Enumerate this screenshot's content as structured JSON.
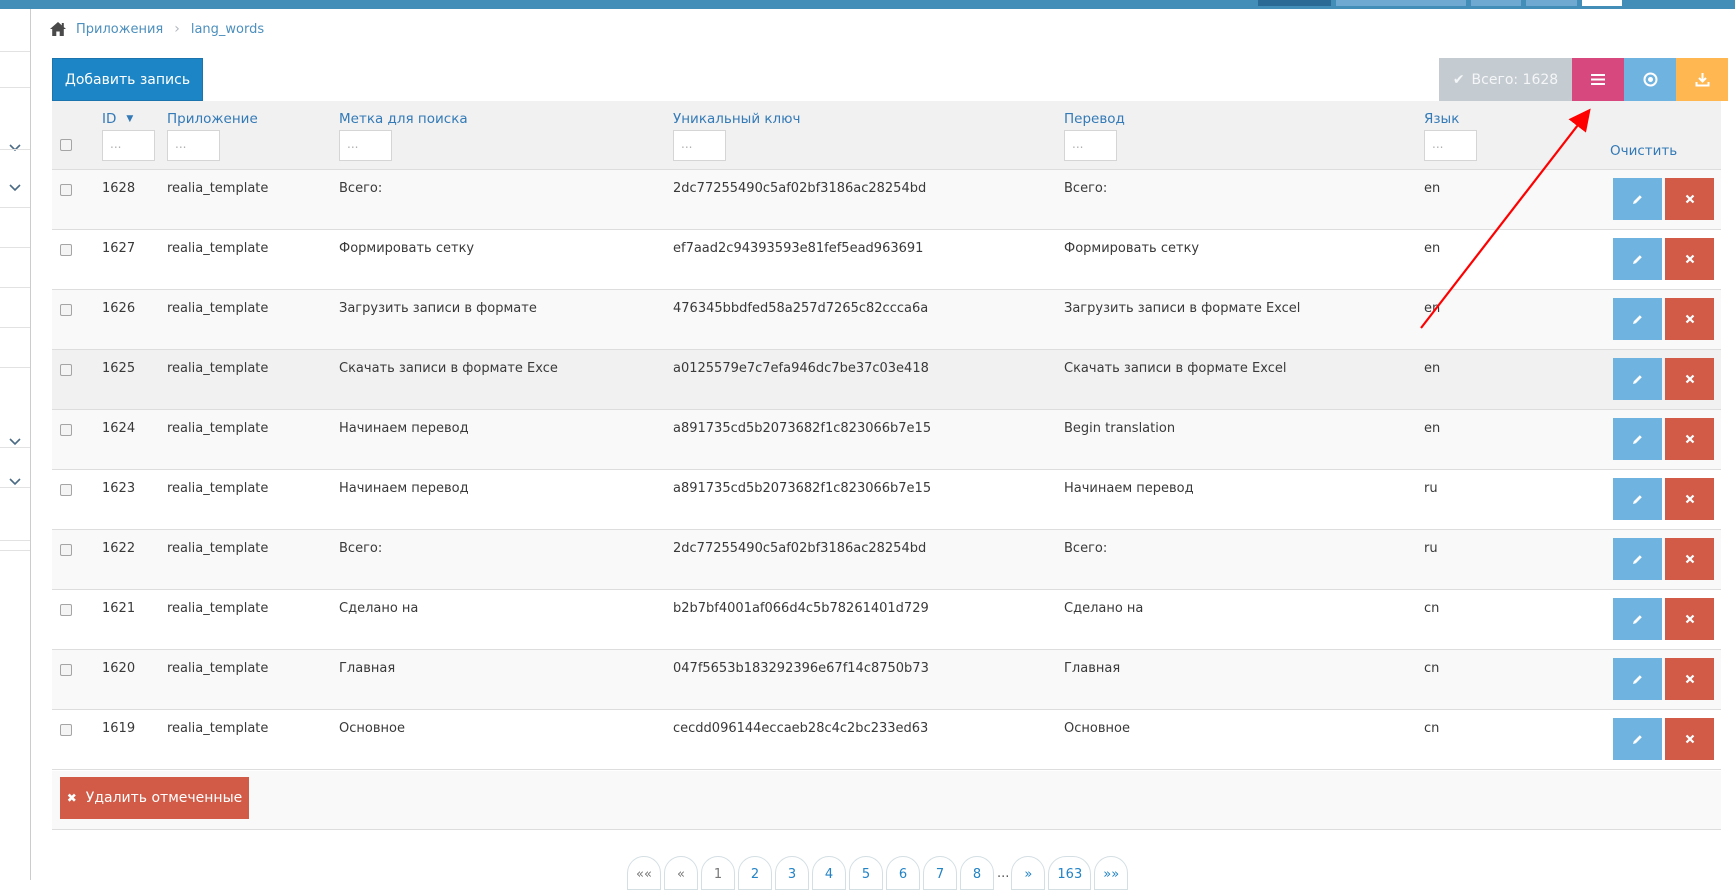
{
  "breadcrumb": {
    "home_icon": "home-icon",
    "items": [
      "Приложения",
      "lang_words"
    ]
  },
  "toolbar": {
    "add_label": "Добавить запись",
    "total_label": "Всего: 1628",
    "icons": [
      "list-icon",
      "settings-circle-icon",
      "download-icon"
    ],
    "colors": {
      "pink": "#d6487e",
      "blue": "#6fb3e0",
      "orange": "#ffb752",
      "total_bg": "#c4cbd1"
    }
  },
  "table": {
    "headers": {
      "id": "ID",
      "app": "Приложение",
      "search_label": "Метка для поиска",
      "unique_key": "Уникальный ключ",
      "translation": "Перевод",
      "language": "Язык",
      "clear": "Очистить"
    },
    "filter_placeholder": "...",
    "rows": [
      {
        "id": "1628",
        "app": "realia_template",
        "label": "Всего:",
        "key": "2dc77255490c5af02bf3186ac28254bd",
        "translation": "Всего:",
        "lang": "en"
      },
      {
        "id": "1627",
        "app": "realia_template",
        "label": "Формировать сетку",
        "key": "ef7aad2c94393593e81fef5ead963691",
        "translation": "Формировать сетку",
        "lang": "en"
      },
      {
        "id": "1626",
        "app": "realia_template",
        "label": "Загрузить записи в формате",
        "key": "476345bbdfed58a257d7265c82ccca6a",
        "translation": "Загрузить записи в формате Excel",
        "lang": "en"
      },
      {
        "id": "1625",
        "app": "realia_template",
        "label": "Скачать записи в формате Exce",
        "key": "a0125579e7c7efa946dc7be37c03e418",
        "translation": "Скачать записи в формате Excel",
        "lang": "en"
      },
      {
        "id": "1624",
        "app": "realia_template",
        "label": "Начинаем перевод",
        "key": "a891735cd5b2073682f1c823066b7e15",
        "translation": "Begin translation",
        "lang": "en"
      },
      {
        "id": "1623",
        "app": "realia_template",
        "label": "Начинаем перевод",
        "key": "a891735cd5b2073682f1c823066b7e15",
        "translation": "Начинаем перевод",
        "lang": "ru"
      },
      {
        "id": "1622",
        "app": "realia_template",
        "label": "Всего:",
        "key": "2dc77255490c5af02bf3186ac28254bd",
        "translation": "Всего:",
        "lang": "ru"
      },
      {
        "id": "1621",
        "app": "realia_template",
        "label": "Сделано на",
        "key": "b2b7bf4001af066d4c5b78261401d729",
        "translation": "Сделано на",
        "lang": "cn"
      },
      {
        "id": "1620",
        "app": "realia_template",
        "label": "Главная",
        "key": "047f5653b183292396e67f14c8750b73",
        "translation": "Главная",
        "lang": "cn"
      },
      {
        "id": "1619",
        "app": "realia_template",
        "label": "Основное",
        "key": "cecdd096144eccaeb28c4c2bc233ed63",
        "translation": "Основное",
        "lang": "cn"
      }
    ]
  },
  "footer": {
    "delete_selected_label": "Удалить отмеченные"
  },
  "pagination": {
    "first": "««",
    "prev": "«",
    "pages": [
      "1",
      "2",
      "3",
      "4",
      "5",
      "6",
      "7",
      "8"
    ],
    "ellipsis": "...",
    "next": "»",
    "last_page": "163",
    "last": "»»"
  },
  "annotation": {
    "arrow_color": "#ff0000"
  }
}
